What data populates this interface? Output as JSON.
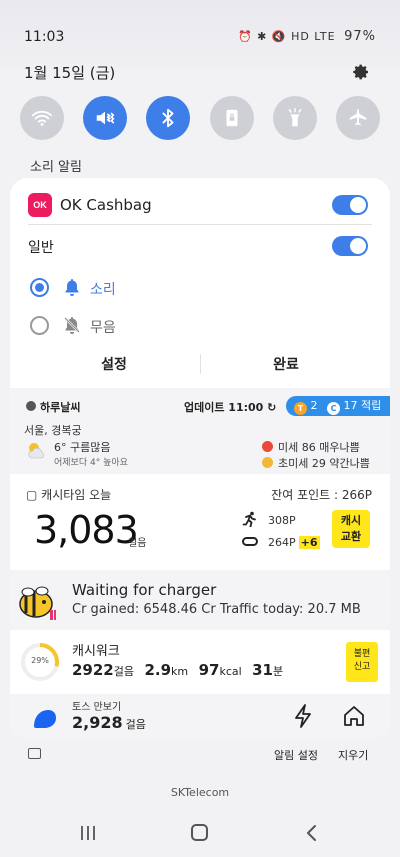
{
  "status_bar": {
    "time": "11:03",
    "icons": "⏰ ✱ 🔇 HD LTE",
    "battery": "97%"
  },
  "date": "1월 15일 (금)",
  "quick_settings": {
    "accent": "#3e7ee8",
    "buttons": [
      {
        "name": "wifi-icon",
        "on": false
      },
      {
        "name": "sound-mute-icon",
        "on": true
      },
      {
        "name": "bluetooth-icon",
        "on": true
      },
      {
        "name": "lock-rotation-icon",
        "on": false
      },
      {
        "name": "flashlight-icon",
        "on": false
      },
      {
        "name": "airplane-icon",
        "on": false
      }
    ]
  },
  "notification_settings": {
    "section_label": "소리 알림",
    "app_name": "OK Cashbag",
    "app_logo_text": "OK",
    "category_label": "일반",
    "options": [
      {
        "label": "소리",
        "selected": true
      },
      {
        "label": "무음",
        "selected": false
      }
    ],
    "settings_button": "설정",
    "done_button": "완료"
  },
  "weather": {
    "title": "하루날씨",
    "update_text": "업데이트 11:00",
    "badge_t": "T",
    "badge_t_count": "2",
    "badge_c": "C",
    "badge_points": "17 적립",
    "location": "서울, 경복궁",
    "temp_condition": "6° 구름많음",
    "compare": "어제보다 4° 높아요",
    "fine_dust": "미세 86 매우나쁨",
    "ultra_fine_dust": "초미세 29 약간나쁨"
  },
  "cashtime": {
    "title": "캐시타임 오늘",
    "remaining_points": "잔여 포인트 : 266P",
    "steps": "3,083",
    "steps_unit": "걸음",
    "walk_points": "308P",
    "other_points": "264P",
    "bonus": "+6",
    "exchange_button": "캐시\n교환"
  },
  "charger": {
    "title": "Waiting for charger",
    "subtitle": "Cr gained: 6548.46 Cr  Traffic today: 20.7 MB"
  },
  "cashwalk": {
    "title": "캐시워크",
    "progress_percent": 29,
    "progress_label": "29%",
    "steps": "2922",
    "steps_unit": "걸음",
    "distance": "2.9",
    "distance_unit": "km",
    "calories": "97",
    "calories_unit": "kcal",
    "minutes": "31",
    "minutes_unit": "분",
    "report_button": "불편\n신고"
  },
  "toss": {
    "title": "토스 만보기",
    "steps": "2,928",
    "steps_unit": "걸음"
  },
  "footer": {
    "notif_settings": "알림 설정",
    "clear_all": "지우기",
    "carrier": "SKTelecom"
  }
}
